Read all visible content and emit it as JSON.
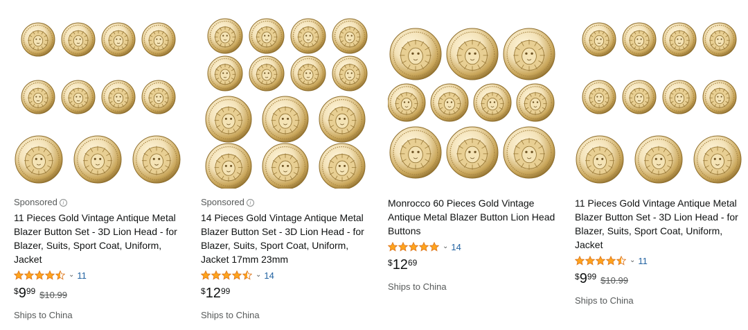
{
  "products": [
    {
      "sponsored_label": "Sponsored",
      "info_glyph": "i",
      "title": "11 Pieces Gold Vintage Antique Metal Blazer Button Set - 3D Lion Head - for Blazer, Suits, Sport Coat, Uniform, Jacket",
      "rating": 4.5,
      "review_count": "11",
      "price_symbol": "$",
      "price_whole": "9",
      "price_fraction": "99",
      "list_price": "$10.99",
      "shipping": "Ships to China",
      "image_style": "set11"
    },
    {
      "sponsored_label": "Sponsored",
      "info_glyph": "i",
      "title": "14 Pieces Gold Vintage Antique Metal Blazer Button Set - 3D Lion Head - for Blazer, Suits, Sport Coat, Uniform, Jacket 17mm 23mm",
      "rating": 4.5,
      "review_count": "14",
      "price_symbol": "$",
      "price_whole": "12",
      "price_fraction": "99",
      "list_price": "",
      "shipping": "Ships to China",
      "image_style": "set14"
    },
    {
      "sponsored_label": "",
      "info_glyph": "",
      "title": "Monrocco 60 Pieces Gold Vintage Antique Metal Blazer Button Lion Head Buttons",
      "rating": 5,
      "review_count": "14",
      "price_symbol": "$",
      "price_whole": "12",
      "price_fraction": "69",
      "list_price": "",
      "shipping": "Ships to China",
      "image_style": "set10"
    },
    {
      "sponsored_label": "",
      "info_glyph": "",
      "title": "11 Pieces Gold Vintage Antique Metal Blazer Button Set - 3D Lion Head - for Blazer, Suits, Sport Coat, Uniform, Jacket",
      "rating": 4.5,
      "review_count": "11",
      "price_symbol": "$",
      "price_whole": "9",
      "price_fraction": "99",
      "list_price": "$10.99",
      "shipping": "Ships to China",
      "image_style": "set11"
    }
  ],
  "icons": {
    "star": "star-icon",
    "chevron": "chevron-down-icon",
    "info": "info-icon",
    "button_image": "lion-head-button-image"
  },
  "colors": {
    "star_fill": "#ffa41c",
    "star_stroke": "#de7921",
    "link": "#2162a1",
    "muted": "#565959",
    "text": "#0f1111",
    "gold_light": "#f3e2b8",
    "gold_dark": "#8a6a2a"
  },
  "chevron_glyph": "⌄"
}
